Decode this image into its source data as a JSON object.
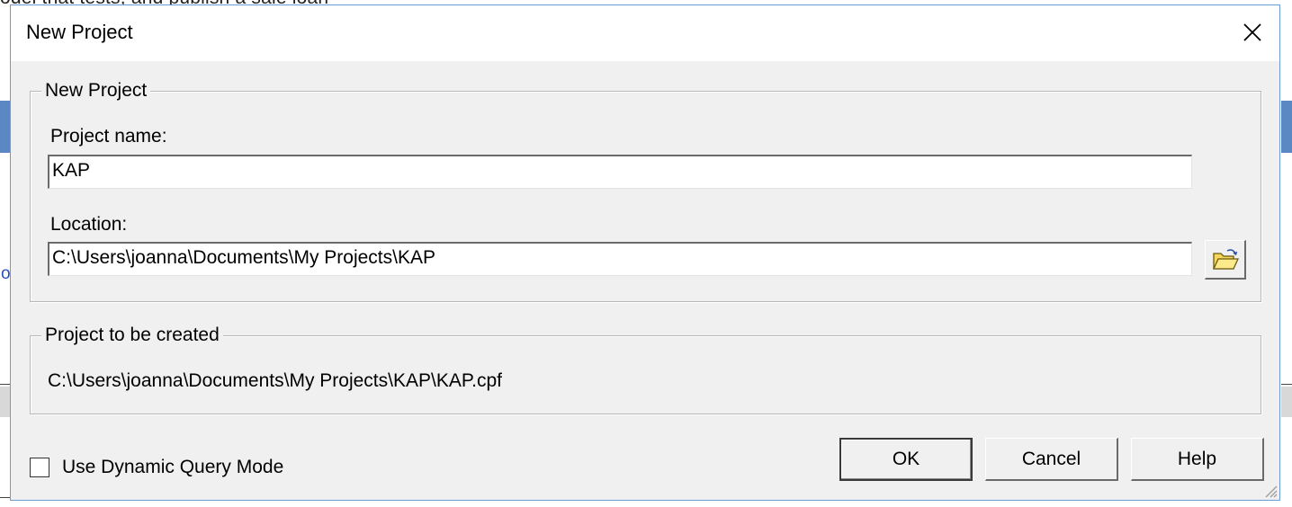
{
  "background": {
    "partial_text": "odel that tests, and publish a sale loan"
  },
  "dialog": {
    "title": "New Project",
    "close_icon": "close-icon",
    "new_project_group": {
      "legend": "New Project",
      "project_name_label": "Project name:",
      "project_name_value": "KAP",
      "location_label": "Location:",
      "location_value": "C:\\Users\\joanna\\Documents\\My Projects\\KAP",
      "browse_icon": "folder-open-icon"
    },
    "created_group": {
      "legend": "Project to be created",
      "path": "C:\\Users\\joanna\\Documents\\My Projects\\KAP\\KAP.cpf"
    },
    "dynamic_query": {
      "label": "Use Dynamic Query Mode",
      "checked": false
    },
    "buttons": {
      "ok": "OK",
      "cancel": "Cancel",
      "help": "Help"
    }
  }
}
